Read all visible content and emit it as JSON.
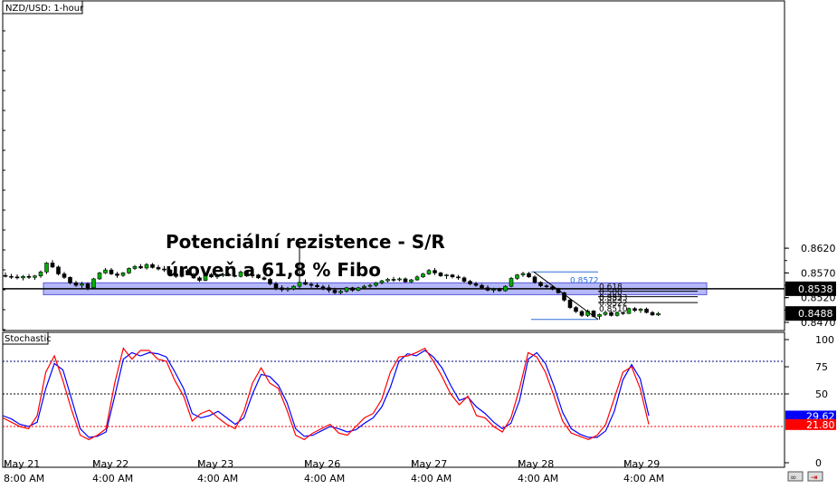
{
  "chart_data": [
    {
      "type": "candlestick",
      "title": "NZD/USD: 1-hour",
      "y_ticks": [
        "0.8620",
        "0.8570",
        "0.8520",
        "0.8470"
      ],
      "ylim": [
        0.8462,
        0.8642
      ],
      "x_ticks": [
        {
          "date": "May 21",
          "time": "8:00 AM"
        },
        {
          "date": "May 22",
          "time": "4:00 AM"
        },
        {
          "date": "May 23",
          "time": "4:00 AM"
        },
        {
          "date": "May 26",
          "time": "4:00 AM"
        },
        {
          "date": "May 27",
          "time": "4:00 AM"
        },
        {
          "date": "May 28",
          "time": "4:00 AM"
        },
        {
          "date": "May 29",
          "time": "4:00 AM"
        }
      ],
      "price_badges": [
        {
          "label": "0.8538",
          "value": 0.8538
        },
        {
          "label": "0.8488",
          "value": 0.8488
        }
      ],
      "horizontal_line": 0.8538,
      "sr_zone": [
        0.8526,
        0.855
      ],
      "annotation": [
        "Potenciální rezistence - S/R",
        "úroveň a 61,8 % Fibo"
      ],
      "fibonacci": {
        "high": 0.8572,
        "low": 0.8476,
        "high_label": "0.8572",
        "levels": [
          {
            "ratio": "0.618",
            "price": "0.8533",
            "value": 0.8533
          },
          {
            "ratio": "0.500",
            "price": "0.8522",
            "value": 0.8522
          },
          {
            "ratio": "0.382",
            "price": "0.8510",
            "value": 0.851
          }
        ]
      },
      "candles": [
        [
          0.8565,
          0.8571,
          0.8561,
          0.8563
        ],
        [
          0.8563,
          0.8568,
          0.8558,
          0.8562
        ],
        [
          0.8562,
          0.8567,
          0.8557,
          0.856
        ],
        [
          0.856,
          0.8566,
          0.8555,
          0.8563
        ],
        [
          0.8563,
          0.8568,
          0.8558,
          0.8561
        ],
        [
          0.8561,
          0.8566,
          0.8556,
          0.8564
        ],
        [
          0.8564,
          0.8575,
          0.856,
          0.8572
        ],
        [
          0.8572,
          0.8592,
          0.8568,
          0.859
        ],
        [
          0.859,
          0.8596,
          0.858,
          0.8582
        ],
        [
          0.8582,
          0.8585,
          0.8565,
          0.8568
        ],
        [
          0.8568,
          0.8572,
          0.8558,
          0.8561
        ],
        [
          0.8561,
          0.8563,
          0.8547,
          0.855
        ],
        [
          0.855,
          0.8554,
          0.8542,
          0.8545
        ],
        [
          0.8545,
          0.8552,
          0.8538,
          0.8548
        ],
        [
          0.8548,
          0.8551,
          0.8535,
          0.854
        ],
        [
          0.854,
          0.856,
          0.8538,
          0.8558
        ],
        [
          0.8558,
          0.8572,
          0.8556,
          0.857
        ],
        [
          0.857,
          0.858,
          0.8568,
          0.8576
        ],
        [
          0.8576,
          0.858,
          0.8566,
          0.8568
        ],
        [
          0.8568,
          0.8572,
          0.856,
          0.8565
        ],
        [
          0.8565,
          0.8572,
          0.8562,
          0.857
        ],
        [
          0.857,
          0.8581,
          0.8568,
          0.8579
        ],
        [
          0.8579,
          0.8586,
          0.8576,
          0.8583
        ],
        [
          0.8583,
          0.8588,
          0.8578,
          0.858
        ],
        [
          0.858,
          0.859,
          0.8577,
          0.8587
        ],
        [
          0.8587,
          0.859,
          0.8579,
          0.8581
        ],
        [
          0.8581,
          0.8586,
          0.8575,
          0.8578
        ],
        [
          0.8578,
          0.8584,
          0.8572,
          0.8576
        ],
        [
          0.8576,
          0.8578,
          0.8566,
          0.8568
        ],
        [
          0.8568,
          0.8572,
          0.856,
          0.8563
        ],
        [
          0.8563,
          0.8578,
          0.8561,
          0.8575
        ],
        [
          0.8575,
          0.8578,
          0.8565,
          0.8566
        ],
        [
          0.8566,
          0.857,
          0.8558,
          0.856
        ],
        [
          0.856,
          0.8563,
          0.8552,
          0.8555
        ],
        [
          0.8555,
          0.857,
          0.8553,
          0.8567
        ],
        [
          0.8567,
          0.857,
          0.856,
          0.8562
        ],
        [
          0.8562,
          0.8568,
          0.8558,
          0.8565
        ],
        [
          0.8565,
          0.857,
          0.8562,
          0.8567
        ],
        [
          0.8567,
          0.857,
          0.8563,
          0.8565
        ],
        [
          0.8565,
          0.8569,
          0.8561,
          0.8563
        ],
        [
          0.8563,
          0.8575,
          0.8561,
          0.8572
        ],
        [
          0.8572,
          0.8575,
          0.8562,
          0.8564
        ],
        [
          0.8564,
          0.8568,
          0.856,
          0.8566
        ],
        [
          0.8566,
          0.8568,
          0.8558,
          0.856
        ],
        [
          0.856,
          0.8563,
          0.8555,
          0.8557
        ],
        [
          0.8557,
          0.856,
          0.8545,
          0.8548
        ],
        [
          0.8548,
          0.8552,
          0.8535,
          0.854
        ],
        [
          0.854,
          0.8545,
          0.8532,
          0.8536
        ],
        [
          0.8536,
          0.8542,
          0.8532,
          0.8538
        ],
        [
          0.8538,
          0.8545,
          0.8535,
          0.8543
        ],
        [
          0.8543,
          0.863,
          0.8538,
          0.8551
        ],
        [
          0.8551,
          0.8557,
          0.8545,
          0.8547
        ],
        [
          0.8547,
          0.8551,
          0.854,
          0.8545
        ],
        [
          0.8545,
          0.855,
          0.8538,
          0.8542
        ],
        [
          0.8542,
          0.8546,
          0.8535,
          0.854
        ],
        [
          0.854,
          0.8546,
          0.853,
          0.8535
        ],
        [
          0.8535,
          0.854,
          0.8527,
          0.853
        ],
        [
          0.853,
          0.8536,
          0.8527,
          0.8533
        ],
        [
          0.8533,
          0.8542,
          0.853,
          0.854
        ],
        [
          0.854,
          0.8542,
          0.8532,
          0.8535
        ],
        [
          0.8535,
          0.8542,
          0.8533,
          0.854
        ],
        [
          0.854,
          0.8546,
          0.8537,
          0.8543
        ],
        [
          0.8543,
          0.8548,
          0.854,
          0.8545
        ],
        [
          0.8545,
          0.8552,
          0.8542,
          0.855
        ],
        [
          0.855,
          0.8556,
          0.8547,
          0.8554
        ],
        [
          0.8554,
          0.856,
          0.8551,
          0.8557
        ],
        [
          0.8557,
          0.8562,
          0.8552,
          0.8556
        ],
        [
          0.8556,
          0.8561,
          0.8553,
          0.8558
        ],
        [
          0.8558,
          0.8561,
          0.855,
          0.8552
        ],
        [
          0.8552,
          0.8558,
          0.855,
          0.8556
        ],
        [
          0.8556,
          0.8565,
          0.8554,
          0.8562
        ],
        [
          0.8562,
          0.857,
          0.856,
          0.8568
        ],
        [
          0.8568,
          0.8578,
          0.8566,
          0.8575
        ],
        [
          0.8575,
          0.858,
          0.8566,
          0.857
        ],
        [
          0.857,
          0.8572,
          0.8562,
          0.8564
        ],
        [
          0.8564,
          0.8568,
          0.8558,
          0.8566
        ],
        [
          0.8566,
          0.8568,
          0.8559,
          0.8562
        ],
        [
          0.8562,
          0.8566,
          0.8556,
          0.856
        ],
        [
          0.856,
          0.8563,
          0.855,
          0.8553
        ],
        [
          0.8553,
          0.8556,
          0.8545,
          0.8548
        ],
        [
          0.8548,
          0.8552,
          0.8542,
          0.8545
        ],
        [
          0.8545,
          0.8548,
          0.8537,
          0.854
        ],
        [
          0.854,
          0.8545,
          0.8533,
          0.8535
        ],
        [
          0.8535,
          0.854,
          0.853,
          0.8537
        ],
        [
          0.8537,
          0.854,
          0.8532,
          0.8534
        ],
        [
          0.8534,
          0.8545,
          0.8532,
          0.8543
        ],
        [
          0.8543,
          0.8562,
          0.8541,
          0.8559
        ],
        [
          0.8559,
          0.8568,
          0.8556,
          0.8566
        ],
        [
          0.8566,
          0.8572,
          0.8562,
          0.8569
        ],
        [
          0.8569,
          0.8572,
          0.856,
          0.8562
        ],
        [
          0.8562,
          0.8565,
          0.8548,
          0.8551
        ],
        [
          0.8551,
          0.8553,
          0.8541,
          0.8544
        ],
        [
          0.8544,
          0.8547,
          0.8539,
          0.8542
        ],
        [
          0.8542,
          0.8545,
          0.8535,
          0.8537
        ],
        [
          0.8537,
          0.854,
          0.8528,
          0.853
        ],
        [
          0.853,
          0.8532,
          0.8512,
          0.8515
        ],
        [
          0.8515,
          0.8518,
          0.8497,
          0.85
        ],
        [
          0.85,
          0.8503,
          0.8489,
          0.8492
        ],
        [
          0.8492,
          0.8495,
          0.8481,
          0.8484
        ],
        [
          0.8484,
          0.8496,
          0.8481,
          0.8493
        ],
        [
          0.8493,
          0.8495,
          0.848,
          0.8482
        ],
        [
          0.8482,
          0.8488,
          0.8476,
          0.8486
        ],
        [
          0.8486,
          0.8492,
          0.8483,
          0.849
        ],
        [
          0.849,
          0.8493,
          0.8482,
          0.8484
        ],
        [
          0.8484,
          0.8492,
          0.8482,
          0.849
        ],
        [
          0.849,
          0.8492,
          0.8485,
          0.8488
        ],
        [
          0.8488,
          0.85,
          0.8487,
          0.8498
        ],
        [
          0.8498,
          0.8501,
          0.8491,
          0.8494
        ],
        [
          0.8494,
          0.8499,
          0.8489,
          0.8497
        ],
        [
          0.8497,
          0.85,
          0.8488,
          0.849
        ],
        [
          0.849,
          0.8493,
          0.8483,
          0.8485
        ],
        [
          0.8485,
          0.8491,
          0.8483,
          0.8488
        ]
      ]
    },
    {
      "type": "line",
      "title": "Stochastic",
      "y_ticks": [
        "100",
        "75",
        "50",
        "0"
      ],
      "ylim": [
        0,
        100
      ],
      "reference_lines": [
        80,
        50,
        20
      ],
      "badges": [
        {
          "label": "29.62",
          "value": 29.62,
          "color": "#0000ff"
        },
        {
          "label": "21.80",
          "value": 21.8,
          "color": "#ff0000"
        }
      ],
      "series": [
        {
          "color": "#0000ff",
          "values": [
            30,
            27,
            22,
            20,
            24,
            55,
            78,
            72,
            45,
            18,
            10,
            11,
            15,
            48,
            82,
            88,
            85,
            88,
            87,
            84,
            70,
            55,
            32,
            28,
            30,
            34,
            28,
            22,
            28,
            50,
            68,
            66,
            58,
            42,
            18,
            11,
            12,
            16,
            20,
            18,
            15,
            17,
            23,
            28,
            38,
            56,
            80,
            87,
            85,
            90,
            84,
            74,
            58,
            44,
            47,
            38,
            32,
            24,
            18,
            23,
            44,
            82,
            88,
            78,
            57,
            33,
            18,
            13,
            10,
            10,
            16,
            34,
            63,
            77,
            64,
            30
          ]
        },
        {
          "color": "#ff0000",
          "values": [
            28,
            24,
            20,
            18,
            30,
            70,
            85,
            62,
            35,
            12,
            8,
            12,
            18,
            60,
            92,
            82,
            90,
            90,
            82,
            80,
            62,
            48,
            25,
            32,
            35,
            28,
            22,
            18,
            34,
            60,
            74,
            60,
            55,
            35,
            12,
            8,
            14,
            18,
            22,
            14,
            12,
            20,
            28,
            32,
            45,
            70,
            84,
            85,
            88,
            92,
            80,
            66,
            50,
            40,
            48,
            30,
            28,
            20,
            15,
            28,
            55,
            88,
            84,
            70,
            48,
            25,
            14,
            11,
            8,
            12,
            22,
            46,
            70,
            75,
            55,
            22
          ]
        }
      ]
    }
  ],
  "bottom_icons": [
    "chain-link-icon",
    "scroll-right-icon"
  ]
}
